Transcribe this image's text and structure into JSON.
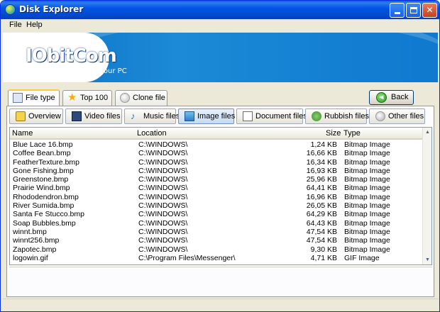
{
  "window": {
    "title": "Disk Explorer"
  },
  "menu": {
    "file": "File",
    "help": "Help"
  },
  "banner": {
    "logo": "IObitCom",
    "tagline": "Care For Your PC"
  },
  "main_tabs": [
    {
      "label": "File type",
      "icon": "file-type-icon"
    },
    {
      "label": "Top 100",
      "icon": "star-icon"
    },
    {
      "label": "Clone file",
      "icon": "clone-icon"
    }
  ],
  "back_button": {
    "label": "Back",
    "icon": "back-arrow-icon"
  },
  "sub_tabs": [
    {
      "label": "Overview",
      "icon": "overview-icon"
    },
    {
      "label": "Video files",
      "icon": "video-icon"
    },
    {
      "label": "Music files",
      "icon": "music-icon"
    },
    {
      "label": "Image files",
      "icon": "image-icon"
    },
    {
      "label": "Document files",
      "icon": "document-icon"
    },
    {
      "label": "Rubbish files",
      "icon": "rubbish-icon"
    },
    {
      "label": "Other files",
      "icon": "other-icon"
    }
  ],
  "table": {
    "columns": {
      "name": "Name",
      "location": "Location",
      "size": "Size",
      "type": "Type"
    },
    "rows": [
      {
        "name": "Blue Lace 16.bmp",
        "location": "C:\\WINDOWS\\",
        "size": "1,24 KB",
        "type": "Bitmap Image"
      },
      {
        "name": "Coffee Bean.bmp",
        "location": "C:\\WINDOWS\\",
        "size": "16,66 KB",
        "type": "Bitmap Image"
      },
      {
        "name": "FeatherTexture.bmp",
        "location": "C:\\WINDOWS\\",
        "size": "16,34 KB",
        "type": "Bitmap Image"
      },
      {
        "name": "Gone Fishing.bmp",
        "location": "C:\\WINDOWS\\",
        "size": "16,93 KB",
        "type": "Bitmap Image"
      },
      {
        "name": "Greenstone.bmp",
        "location": "C:\\WINDOWS\\",
        "size": "25,96 KB",
        "type": "Bitmap Image"
      },
      {
        "name": "Prairie Wind.bmp",
        "location": "C:\\WINDOWS\\",
        "size": "64,41 KB",
        "type": "Bitmap Image"
      },
      {
        "name": "Rhododendron.bmp",
        "location": "C:\\WINDOWS\\",
        "size": "16,96 KB",
        "type": "Bitmap Image"
      },
      {
        "name": "River Sumida.bmp",
        "location": "C:\\WINDOWS\\",
        "size": "26,05 KB",
        "type": "Bitmap Image"
      },
      {
        "name": "Santa Fe Stucco.bmp",
        "location": "C:\\WINDOWS\\",
        "size": "64,29 KB",
        "type": "Bitmap Image"
      },
      {
        "name": "Soap Bubbles.bmp",
        "location": "C:\\WINDOWS\\",
        "size": "64,43 KB",
        "type": "Bitmap Image"
      },
      {
        "name": "winnt.bmp",
        "location": "C:\\WINDOWS\\",
        "size": "47,54 KB",
        "type": "Bitmap Image"
      },
      {
        "name": "winnt256.bmp",
        "location": "C:\\WINDOWS\\",
        "size": "47,54 KB",
        "type": "Bitmap Image"
      },
      {
        "name": "Zapotec.bmp",
        "location": "C:\\WINDOWS\\",
        "size": "9,30 KB",
        "type": "Bitmap Image"
      },
      {
        "name": "logowin.gif",
        "location": "C:\\Program Files\\Messenger\\",
        "size": "4,71 KB",
        "type": "GIF Image"
      }
    ]
  }
}
